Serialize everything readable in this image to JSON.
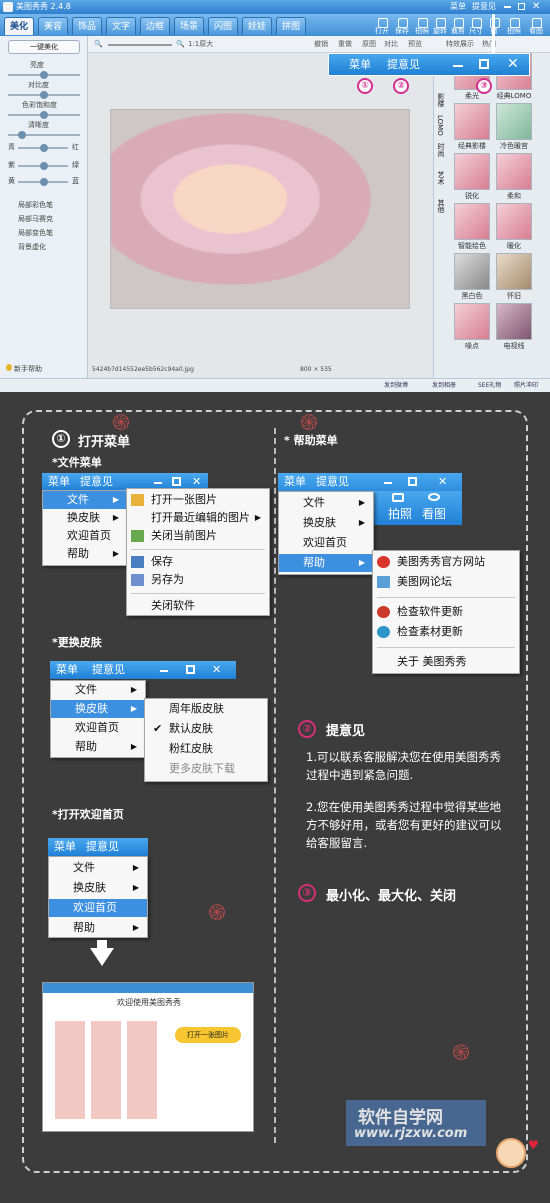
{
  "app": {
    "title": "美图秀秀 2.4.8",
    "menu_label": "菜单",
    "feedback_label": "提意见"
  },
  "tabs": [
    "美化",
    "美容",
    "饰品",
    "文字",
    "边框",
    "场景",
    "闪图",
    "娃娃",
    "拼图"
  ],
  "toolbar_icons": [
    "打开",
    "保存",
    "拍照",
    "旋转",
    "裁剪",
    "尺寸",
    "撤",
    "拍照",
    "看图"
  ],
  "edit_bar": {
    "zoom_actual": "1:1原大",
    "undo": "撤销",
    "redo": "重做",
    "reset": "原图",
    "compare": "对比",
    "preview": "预览",
    "effect": "特效展示",
    "hot": "热门"
  },
  "left_panel": {
    "one_click": "一键美化",
    "brightness": "亮度",
    "contrast": "对比度",
    "saturation": "色彩饱和度",
    "sharpness": "清晰度",
    "cyan": "青",
    "red": "红",
    "magenta": "紫",
    "green": "绿",
    "yellow": "黄",
    "blue": "蓝",
    "tools": [
      "局部彩色笔",
      "局部马赛克",
      "局部变色笔",
      "背景虚化"
    ],
    "help": "新手帮助"
  },
  "canvas": {
    "filename": "5424b7d14552ee5b562c94a0.jpg",
    "dimensions": "800 × 535"
  },
  "side_tabs": [
    "影楼",
    "LOMO",
    "时尚",
    "艺术",
    "其他"
  ],
  "effects": [
    "柔光",
    "经典LOMO",
    "经典影楼",
    "冷色暖宫",
    "锐化",
    "柔和",
    "智能绘色",
    "暖化",
    "黑白色",
    "怀旧",
    "噪点",
    "电视线"
  ],
  "status": {
    "s1": "发到微博",
    "s2": "发到相册",
    "s3": "SEE礼物",
    "s4": "照片冲印"
  },
  "callout": {
    "menu": "菜单",
    "feedback": "提意见",
    "n1": "①",
    "n2": "②",
    "n3": "③"
  },
  "section1": {
    "num": "①",
    "title": "打开菜单",
    "file_menu": "*文件菜单",
    "skin": "*更换皮肤",
    "welcome": "*打开欢迎首页"
  },
  "menu_items": {
    "file": "文件",
    "skin": "换皮肤",
    "home": "欢迎首页",
    "help": "帮助"
  },
  "file_submenu": [
    "打开一张图片",
    "打开最近编辑的图片",
    "关闭当前图片",
    "保存",
    "另存为",
    "关闭软件"
  ],
  "skin_submenu": [
    "周年版皮肤",
    "默认皮肤",
    "粉红皮肤",
    "更多皮肤下载"
  ],
  "help_section": {
    "title": "* 帮助菜单",
    "items": [
      "美图秀秀官方网站",
      "美图网论坛",
      "检查软件更新",
      "检查素材更新",
      "关于 美图秀秀"
    ],
    "photo": "拍照",
    "view": "看图"
  },
  "section2": {
    "num": "②",
    "title": "提意见",
    "p1": "1.可以联系客服解决您在使用美图秀秀过程中遇到紧急问题.",
    "p2": "2.您在使用美图秀秀过程中觉得某些地方不够好用，或者您有更好的建议可以给客服留言."
  },
  "section3": {
    "num": "③",
    "title": "最小化、最大化、关闭"
  },
  "welcome_window": {
    "title": "欢迎使用美图秀秀",
    "open": "打开一张图片"
  },
  "watermark": {
    "cn": "软件自学网",
    "url": "www.rjzxw.com"
  }
}
